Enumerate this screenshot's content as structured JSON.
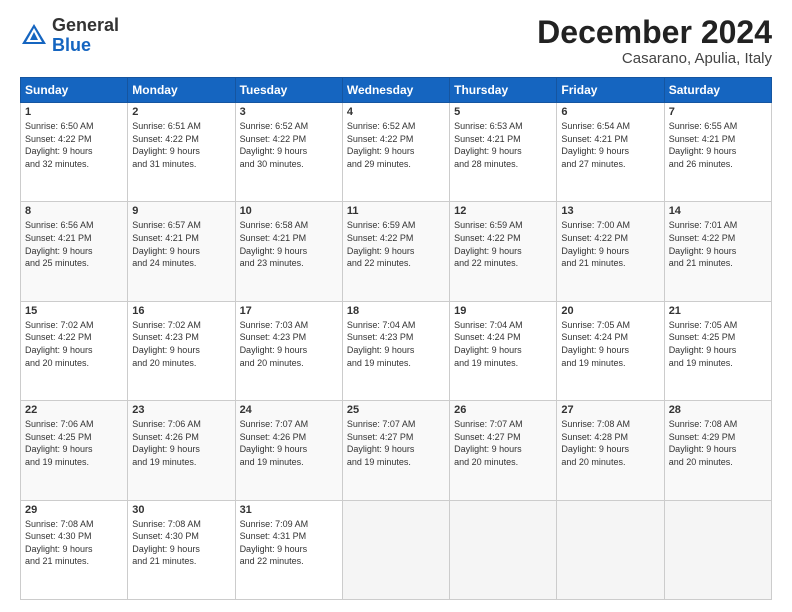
{
  "header": {
    "logo_general": "General",
    "logo_blue": "Blue",
    "month_title": "December 2024",
    "location": "Casarano, Apulia, Italy"
  },
  "days_of_week": [
    "Sunday",
    "Monday",
    "Tuesday",
    "Wednesday",
    "Thursday",
    "Friday",
    "Saturday"
  ],
  "weeks": [
    [
      {
        "day": "1",
        "info": "Sunrise: 6:50 AM\nSunset: 4:22 PM\nDaylight: 9 hours\nand 32 minutes."
      },
      {
        "day": "2",
        "info": "Sunrise: 6:51 AM\nSunset: 4:22 PM\nDaylight: 9 hours\nand 31 minutes."
      },
      {
        "day": "3",
        "info": "Sunrise: 6:52 AM\nSunset: 4:22 PM\nDaylight: 9 hours\nand 30 minutes."
      },
      {
        "day": "4",
        "info": "Sunrise: 6:52 AM\nSunset: 4:22 PM\nDaylight: 9 hours\nand 29 minutes."
      },
      {
        "day": "5",
        "info": "Sunrise: 6:53 AM\nSunset: 4:21 PM\nDaylight: 9 hours\nand 28 minutes."
      },
      {
        "day": "6",
        "info": "Sunrise: 6:54 AM\nSunset: 4:21 PM\nDaylight: 9 hours\nand 27 minutes."
      },
      {
        "day": "7",
        "info": "Sunrise: 6:55 AM\nSunset: 4:21 PM\nDaylight: 9 hours\nand 26 minutes."
      }
    ],
    [
      {
        "day": "8",
        "info": "Sunrise: 6:56 AM\nSunset: 4:21 PM\nDaylight: 9 hours\nand 25 minutes."
      },
      {
        "day": "9",
        "info": "Sunrise: 6:57 AM\nSunset: 4:21 PM\nDaylight: 9 hours\nand 24 minutes."
      },
      {
        "day": "10",
        "info": "Sunrise: 6:58 AM\nSunset: 4:21 PM\nDaylight: 9 hours\nand 23 minutes."
      },
      {
        "day": "11",
        "info": "Sunrise: 6:59 AM\nSunset: 4:22 PM\nDaylight: 9 hours\nand 22 minutes."
      },
      {
        "day": "12",
        "info": "Sunrise: 6:59 AM\nSunset: 4:22 PM\nDaylight: 9 hours\nand 22 minutes."
      },
      {
        "day": "13",
        "info": "Sunrise: 7:00 AM\nSunset: 4:22 PM\nDaylight: 9 hours\nand 21 minutes."
      },
      {
        "day": "14",
        "info": "Sunrise: 7:01 AM\nSunset: 4:22 PM\nDaylight: 9 hours\nand 21 minutes."
      }
    ],
    [
      {
        "day": "15",
        "info": "Sunrise: 7:02 AM\nSunset: 4:22 PM\nDaylight: 9 hours\nand 20 minutes."
      },
      {
        "day": "16",
        "info": "Sunrise: 7:02 AM\nSunset: 4:23 PM\nDaylight: 9 hours\nand 20 minutes."
      },
      {
        "day": "17",
        "info": "Sunrise: 7:03 AM\nSunset: 4:23 PM\nDaylight: 9 hours\nand 20 minutes."
      },
      {
        "day": "18",
        "info": "Sunrise: 7:04 AM\nSunset: 4:23 PM\nDaylight: 9 hours\nand 19 minutes."
      },
      {
        "day": "19",
        "info": "Sunrise: 7:04 AM\nSunset: 4:24 PM\nDaylight: 9 hours\nand 19 minutes."
      },
      {
        "day": "20",
        "info": "Sunrise: 7:05 AM\nSunset: 4:24 PM\nDaylight: 9 hours\nand 19 minutes."
      },
      {
        "day": "21",
        "info": "Sunrise: 7:05 AM\nSunset: 4:25 PM\nDaylight: 9 hours\nand 19 minutes."
      }
    ],
    [
      {
        "day": "22",
        "info": "Sunrise: 7:06 AM\nSunset: 4:25 PM\nDaylight: 9 hours\nand 19 minutes."
      },
      {
        "day": "23",
        "info": "Sunrise: 7:06 AM\nSunset: 4:26 PM\nDaylight: 9 hours\nand 19 minutes."
      },
      {
        "day": "24",
        "info": "Sunrise: 7:07 AM\nSunset: 4:26 PM\nDaylight: 9 hours\nand 19 minutes."
      },
      {
        "day": "25",
        "info": "Sunrise: 7:07 AM\nSunset: 4:27 PM\nDaylight: 9 hours\nand 19 minutes."
      },
      {
        "day": "26",
        "info": "Sunrise: 7:07 AM\nSunset: 4:27 PM\nDaylight: 9 hours\nand 20 minutes."
      },
      {
        "day": "27",
        "info": "Sunrise: 7:08 AM\nSunset: 4:28 PM\nDaylight: 9 hours\nand 20 minutes."
      },
      {
        "day": "28",
        "info": "Sunrise: 7:08 AM\nSunset: 4:29 PM\nDaylight: 9 hours\nand 20 minutes."
      }
    ],
    [
      {
        "day": "29",
        "info": "Sunrise: 7:08 AM\nSunset: 4:30 PM\nDaylight: 9 hours\nand 21 minutes."
      },
      {
        "day": "30",
        "info": "Sunrise: 7:08 AM\nSunset: 4:30 PM\nDaylight: 9 hours\nand 21 minutes."
      },
      {
        "day": "31",
        "info": "Sunrise: 7:09 AM\nSunset: 4:31 PM\nDaylight: 9 hours\nand 22 minutes."
      },
      null,
      null,
      null,
      null
    ]
  ]
}
